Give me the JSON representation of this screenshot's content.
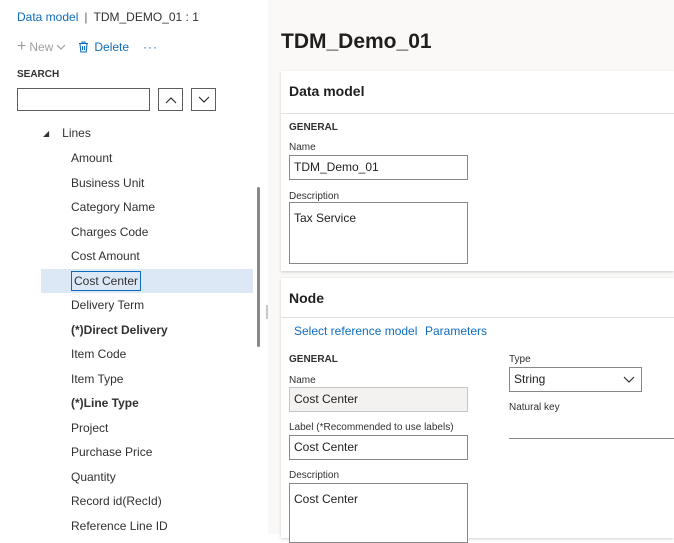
{
  "breadcrumb": {
    "root": "Data model",
    "sep": "|",
    "current": "TDM_DEMO_01 : 1"
  },
  "toolbar": {
    "new_label": "New",
    "delete_label": "Delete",
    "more_label": "···"
  },
  "search": {
    "label": "SEARCH",
    "value": "",
    "up_icon": "chevron-up-icon",
    "down_icon": "chevron-down-icon"
  },
  "tree": {
    "parent_label": "Lines",
    "items": [
      {
        "label": "Amount"
      },
      {
        "label": "Business Unit"
      },
      {
        "label": "Category Name"
      },
      {
        "label": "Charges Code"
      },
      {
        "label": "Cost Amount"
      },
      {
        "label": "Cost Center",
        "selected": true
      },
      {
        "label": "Delivery Term"
      },
      {
        "label": "(*)Direct Delivery",
        "bold": true
      },
      {
        "label": "Item Code"
      },
      {
        "label": "Item Type"
      },
      {
        "label": "(*)Line Type",
        "bold": true
      },
      {
        "label": "Project"
      },
      {
        "label": "Purchase Price"
      },
      {
        "label": "Quantity"
      },
      {
        "label": "Record id(RecId)"
      },
      {
        "label": "Reference Line ID"
      }
    ]
  },
  "page": {
    "title": "TDM_Demo_01"
  },
  "data_model_card": {
    "title": "Data model",
    "section": "GENERAL",
    "name_label": "Name",
    "name_value": "TDM_Demo_01",
    "description_label": "Description",
    "description_value": "Tax Service"
  },
  "node_card": {
    "title": "Node",
    "select_reference_model": "Select reference model",
    "parameters": "Parameters",
    "section": "GENERAL",
    "name_label": "Name",
    "name_value": "Cost Center",
    "label_label": "Label (*Recommended to use labels)",
    "label_value": "Cost Center",
    "description_label": "Description",
    "description_value": "Cost Center",
    "type_label": "Type",
    "type_value": "String",
    "natural_key_label": "Natural key"
  },
  "colors": {
    "accent": "#0f6cbd",
    "selection": "#dde8f7"
  }
}
